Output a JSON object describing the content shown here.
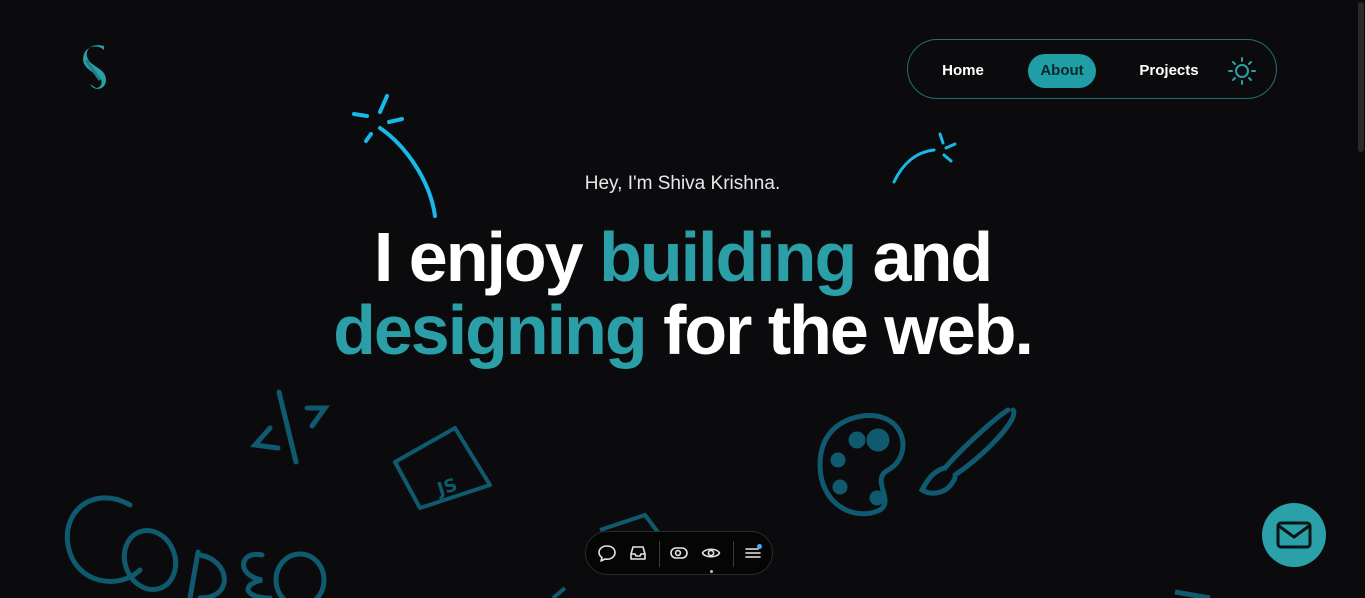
{
  "brand": {
    "logo_icon": "s-logo-icon",
    "accent_color": "#2a9fa7"
  },
  "nav": {
    "items": [
      {
        "label": "Home",
        "active": false
      },
      {
        "label": "About",
        "active": true
      },
      {
        "label": "Projects",
        "active": false
      }
    ],
    "theme_icon": "sun-icon"
  },
  "hero": {
    "greeting": "Hey, I'm Shiva Krishna.",
    "line1": {
      "text_a": "I enjoy ",
      "accent": "building",
      "text_b": " and"
    },
    "line2": {
      "accent": "designing",
      "text_b": " for the web."
    }
  },
  "doodles": [
    "code-brackets-icon",
    "js-file-icon",
    "palette-icon",
    "paintbrush-icon",
    "code-word-icon",
    "sparkle-icon"
  ],
  "dock": {
    "icons": [
      "comment-icon",
      "inbox-icon",
      "preview-icon",
      "eye-icon",
      "menu-icon"
    ],
    "menu_badge_color": "#4ea8ff"
  },
  "fab": {
    "icon": "mail-icon"
  }
}
